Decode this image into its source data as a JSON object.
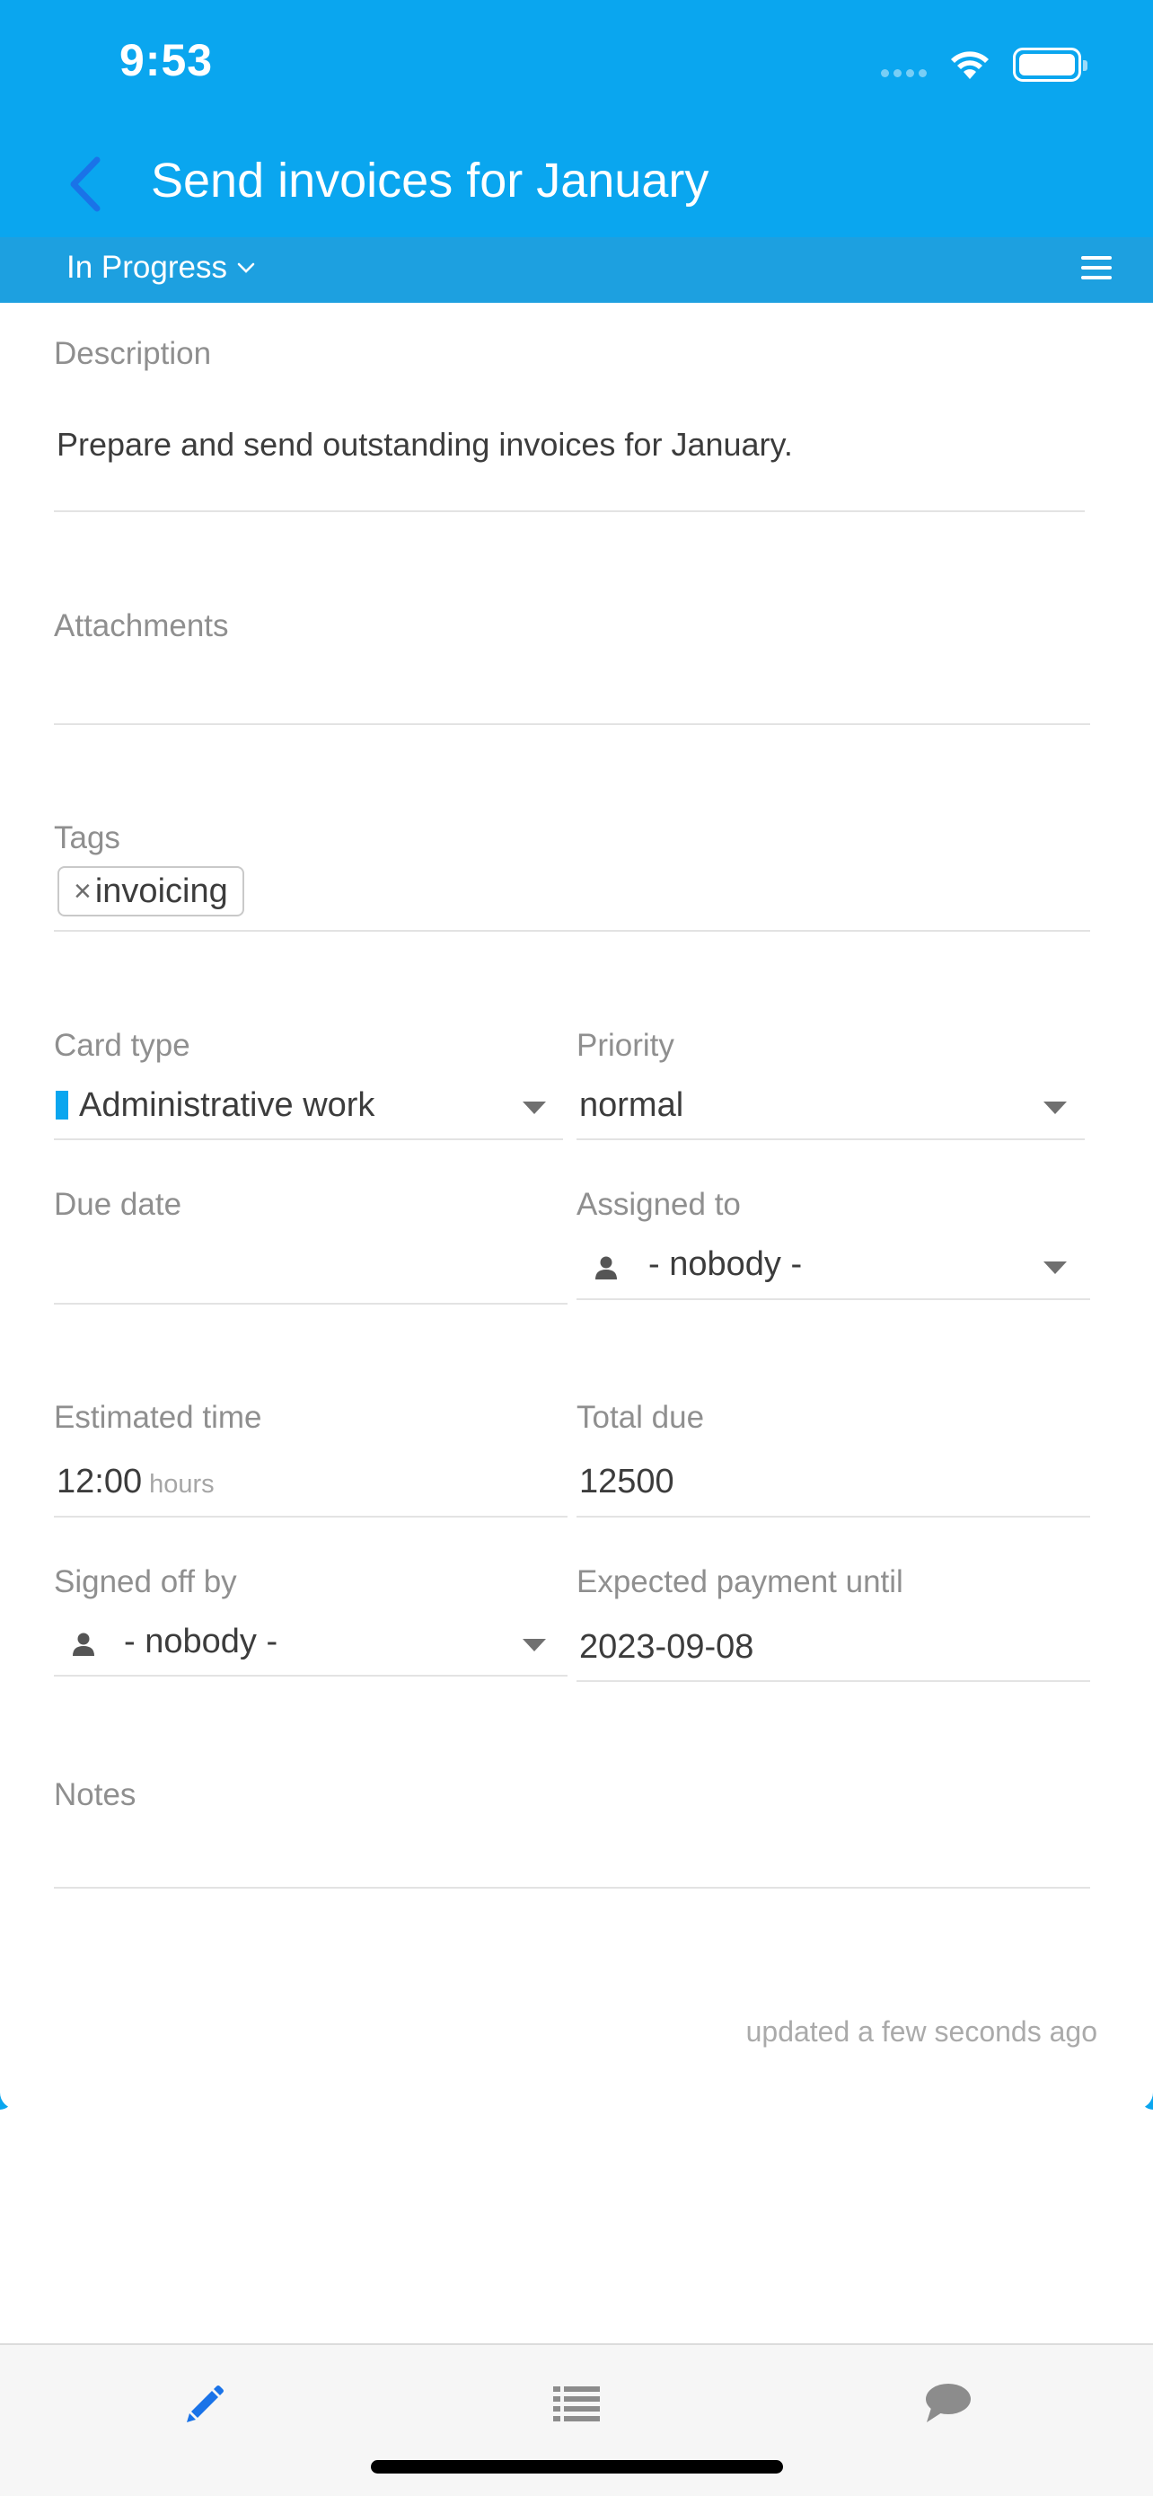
{
  "status_bar": {
    "time": "9:53"
  },
  "nav": {
    "title": "Send invoices for January",
    "status": "In Progress"
  },
  "fields": {
    "description": {
      "label": "Description",
      "value": "Prepare and send outstanding invoices for January."
    },
    "attachments": {
      "label": "Attachments"
    },
    "tags": {
      "label": "Tags",
      "items": [
        "invoicing"
      ],
      "remove_glyph": "×"
    },
    "card_type": {
      "label": "Card type",
      "value": "Administrative work",
      "color": "#0aa6ef"
    },
    "priority": {
      "label": "Priority",
      "value": "normal"
    },
    "due_date": {
      "label": "Due date",
      "value": ""
    },
    "assigned_to": {
      "label": "Assigned to",
      "value": "- nobody -"
    },
    "estimated_time": {
      "label": "Estimated time",
      "value": "12:00",
      "unit": "hours"
    },
    "total_due": {
      "label": "Total due",
      "value": "12500"
    },
    "signed_off_by": {
      "label": "Signed off by",
      "value": "- nobody -"
    },
    "expected_payment": {
      "label": "Expected payment until",
      "value": "2023-09-08"
    },
    "notes": {
      "label": "Notes",
      "value": ""
    }
  },
  "footer": {
    "updated": "updated a few seconds ago"
  },
  "tabs": [
    {
      "icon": "pencil-icon",
      "active": true
    },
    {
      "icon": "list-icon",
      "active": false
    },
    {
      "icon": "chat-bubble-icon",
      "active": false
    }
  ],
  "colors": {
    "header": "#0aa6ef",
    "subbar": "#1da0e0",
    "active_tab": "#1a73e8",
    "inactive_tab": "#8c8c8c"
  }
}
